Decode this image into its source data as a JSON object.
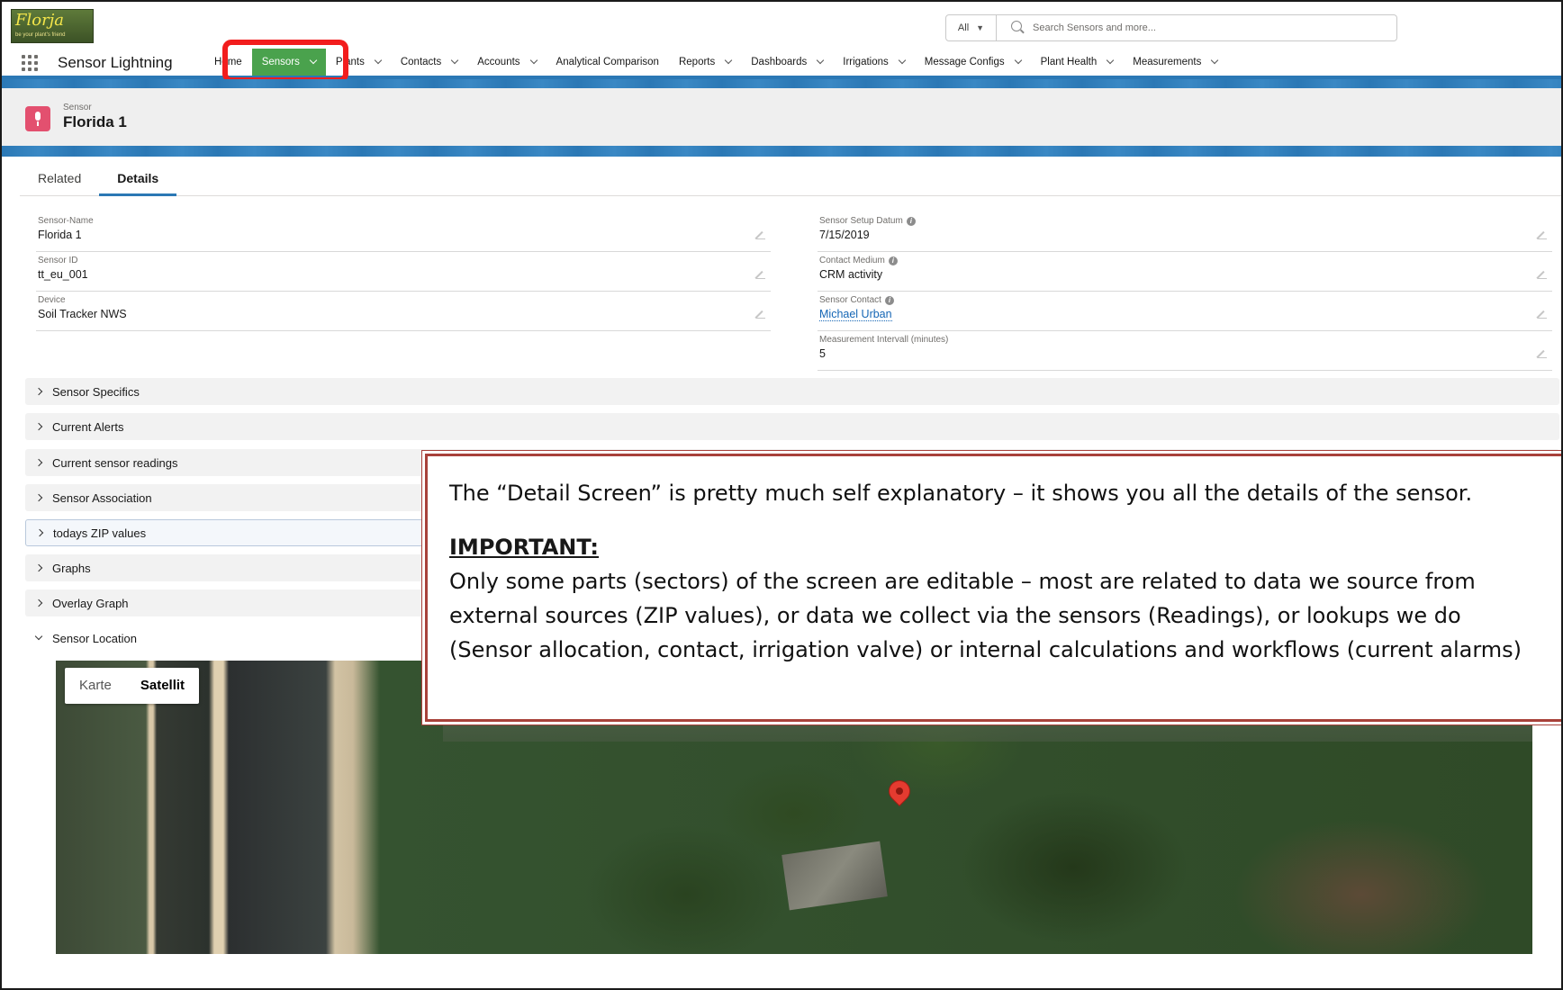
{
  "header": {
    "logo_text": "Florja",
    "logo_tagline": "be your plant's friend",
    "search_scope": "All",
    "search_placeholder": "Search Sensors and more..."
  },
  "nav": {
    "app_name": "Sensor Lightning",
    "items": [
      {
        "label": "Home",
        "dropdown": false
      },
      {
        "label": "Sensors",
        "dropdown": true,
        "active": true
      },
      {
        "label": "Plants",
        "dropdown": true
      },
      {
        "label": "Contacts",
        "dropdown": true
      },
      {
        "label": "Accounts",
        "dropdown": true
      },
      {
        "label": "Analytical Comparison",
        "dropdown": false
      },
      {
        "label": "Reports",
        "dropdown": true
      },
      {
        "label": "Dashboards",
        "dropdown": true
      },
      {
        "label": "Irrigations",
        "dropdown": true
      },
      {
        "label": "Message Configs",
        "dropdown": true
      },
      {
        "label": "Plant Health",
        "dropdown": true
      },
      {
        "label": "Measurements",
        "dropdown": true
      }
    ]
  },
  "record": {
    "type_label": "Sensor",
    "title": "Florida 1"
  },
  "tabs": [
    "Related",
    "Details"
  ],
  "fields_left": [
    {
      "label": "Sensor-Name",
      "value": "Florida 1"
    },
    {
      "label": "Sensor ID",
      "value": "tt_eu_001"
    },
    {
      "label": "Device",
      "value": "Soil Tracker NWS"
    }
  ],
  "fields_right": [
    {
      "label": "Sensor Setup Datum",
      "value": "7/15/2019"
    },
    {
      "label": "Contact Medium",
      "value": "CRM activity"
    },
    {
      "label": "Sensor Contact",
      "value": "Michael Urban"
    },
    {
      "label": "Measurement Intervall (minutes)",
      "value": "5"
    }
  ],
  "sections": [
    "Sensor Specifics",
    "Current Alerts",
    "Current sensor readings",
    "Sensor Association",
    "todays ZIP values",
    "Graphs",
    "Overlay Graph",
    "Sensor Location"
  ],
  "map": {
    "map_label": "Karte",
    "satellite_label": "Satellit"
  },
  "callout": {
    "line1": "The “Detail Screen” is pretty much self explanatory – it shows you all the details of the sensor.",
    "heading": "IMPORTANT:",
    "line2": "Only some parts (sectors) of the screen are editable – most are related to data we source from",
    "line3": "external sources (ZIP values), or data we collect via the sensors (Readings), or lookups we do",
    "line4": "(Sensor allocation, contact, irrigation valve) or internal calculations and workflows (current alarms)"
  },
  "colors": {
    "active_nav": "#4aa24d",
    "highlight_box": "#f21d1d",
    "brand_blue": "#2b78b5",
    "callout_border": "#a8413a"
  }
}
